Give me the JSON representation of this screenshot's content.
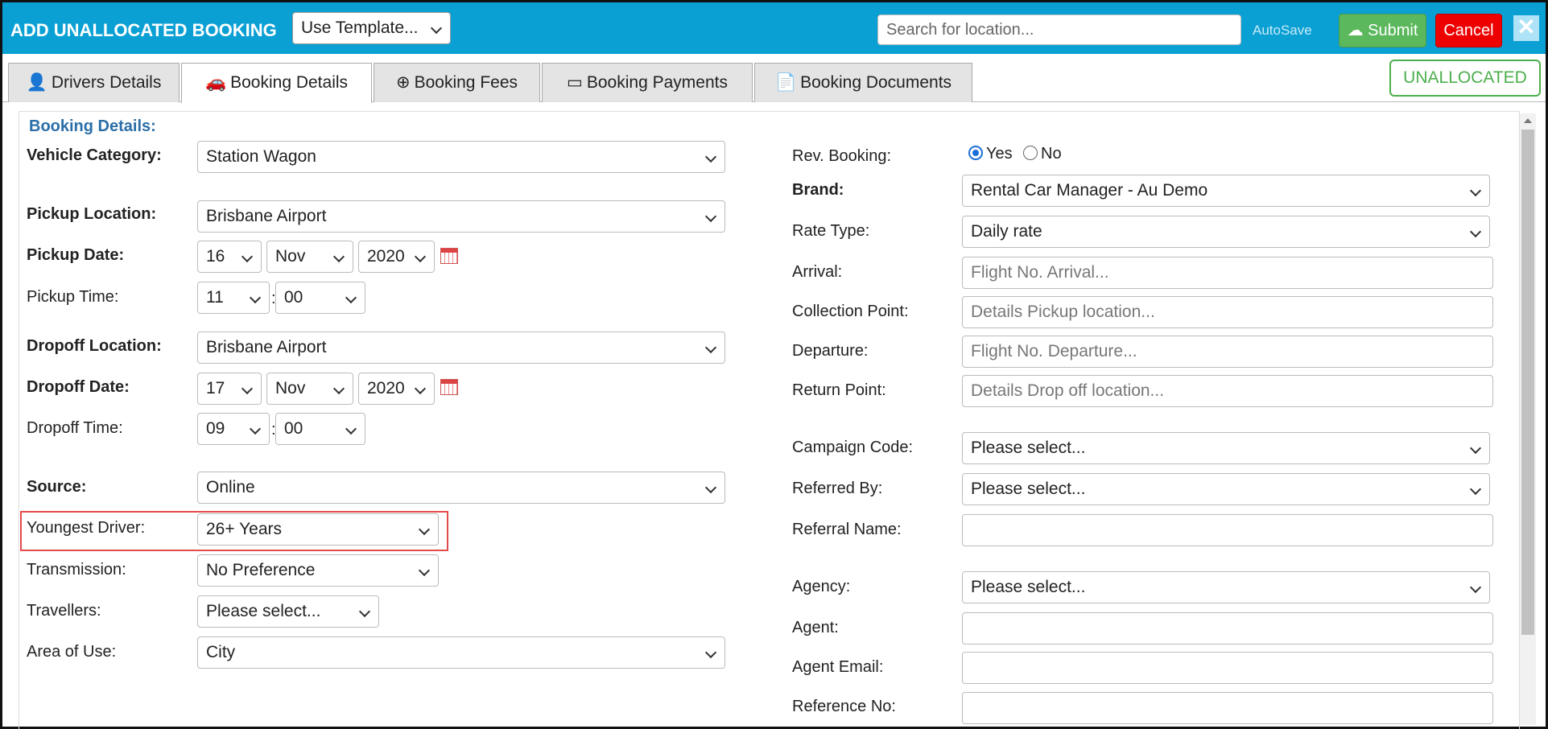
{
  "header": {
    "title": "ADD UNALLOCATED BOOKING",
    "template_select": "Use Template...",
    "search_placeholder": "Search for location...",
    "autosave": "AutoSave",
    "submit": "Submit",
    "cancel": "Cancel",
    "close": "✕"
  },
  "tabs": [
    "Drivers Details",
    "Booking Details",
    "Booking Fees",
    "Booking Payments",
    "Booking Documents"
  ],
  "status_badge": "UNALLOCATED",
  "section_title": "Booking Details:",
  "left": {
    "vehicle_category": {
      "label": "Vehicle Category:",
      "value": "Station Wagon"
    },
    "pickup_location": {
      "label": "Pickup Location:",
      "value": "Brisbane Airport"
    },
    "pickup_date": {
      "label": "Pickup Date:",
      "day": "16",
      "month": "Nov",
      "year": "2020"
    },
    "pickup_time": {
      "label": "Pickup Time:",
      "hour": "11",
      "minute": "00"
    },
    "dropoff_location": {
      "label": "Dropoff Location:",
      "value": "Brisbane Airport"
    },
    "dropoff_date": {
      "label": "Dropoff Date:",
      "day": "17",
      "month": "Nov",
      "year": "2020"
    },
    "dropoff_time": {
      "label": "Dropoff Time:",
      "hour": "09",
      "minute": "00"
    },
    "source": {
      "label": "Source:",
      "value": "Online"
    },
    "youngest_driver": {
      "label": "Youngest Driver:",
      "value": "26+ Years"
    },
    "transmission": {
      "label": "Transmission:",
      "value": "No Preference"
    },
    "travellers": {
      "label": "Travellers:",
      "value": "Please select..."
    },
    "area_of_use": {
      "label": "Area of Use:",
      "value": "City"
    }
  },
  "right": {
    "rev_booking": {
      "label": "Rev. Booking:",
      "yes": "Yes",
      "no": "No",
      "selected": "Yes"
    },
    "brand": {
      "label": "Brand:",
      "value": "Rental Car Manager - Au Demo"
    },
    "rate_type": {
      "label": "Rate Type:",
      "value": "Daily rate"
    },
    "arrival": {
      "label": "Arrival:",
      "placeholder": "Flight No. Arrival..."
    },
    "collection_point": {
      "label": "Collection Point:",
      "placeholder": "Details Pickup location..."
    },
    "departure": {
      "label": "Departure:",
      "placeholder": "Flight No. Departure..."
    },
    "return_point": {
      "label": "Return Point:",
      "placeholder": "Details Drop off location..."
    },
    "campaign_code": {
      "label": "Campaign Code:",
      "value": "Please select..."
    },
    "referred_by": {
      "label": "Referred By:",
      "value": "Please select..."
    },
    "referral_name": {
      "label": "Referral Name:",
      "value": ""
    },
    "agency": {
      "label": "Agency:",
      "value": "Please select..."
    },
    "agent": {
      "label": "Agent:",
      "value": ""
    },
    "agent_email": {
      "label": "Agent Email:",
      "value": ""
    },
    "reference_no": {
      "label": "Reference No:",
      "value": ""
    }
  },
  "colors": {
    "header": "#0aa0d4",
    "submit": "#5cb85c",
    "cancel": "#ee0000",
    "status": "#4cae4c",
    "highlight": "#e34a4a"
  }
}
